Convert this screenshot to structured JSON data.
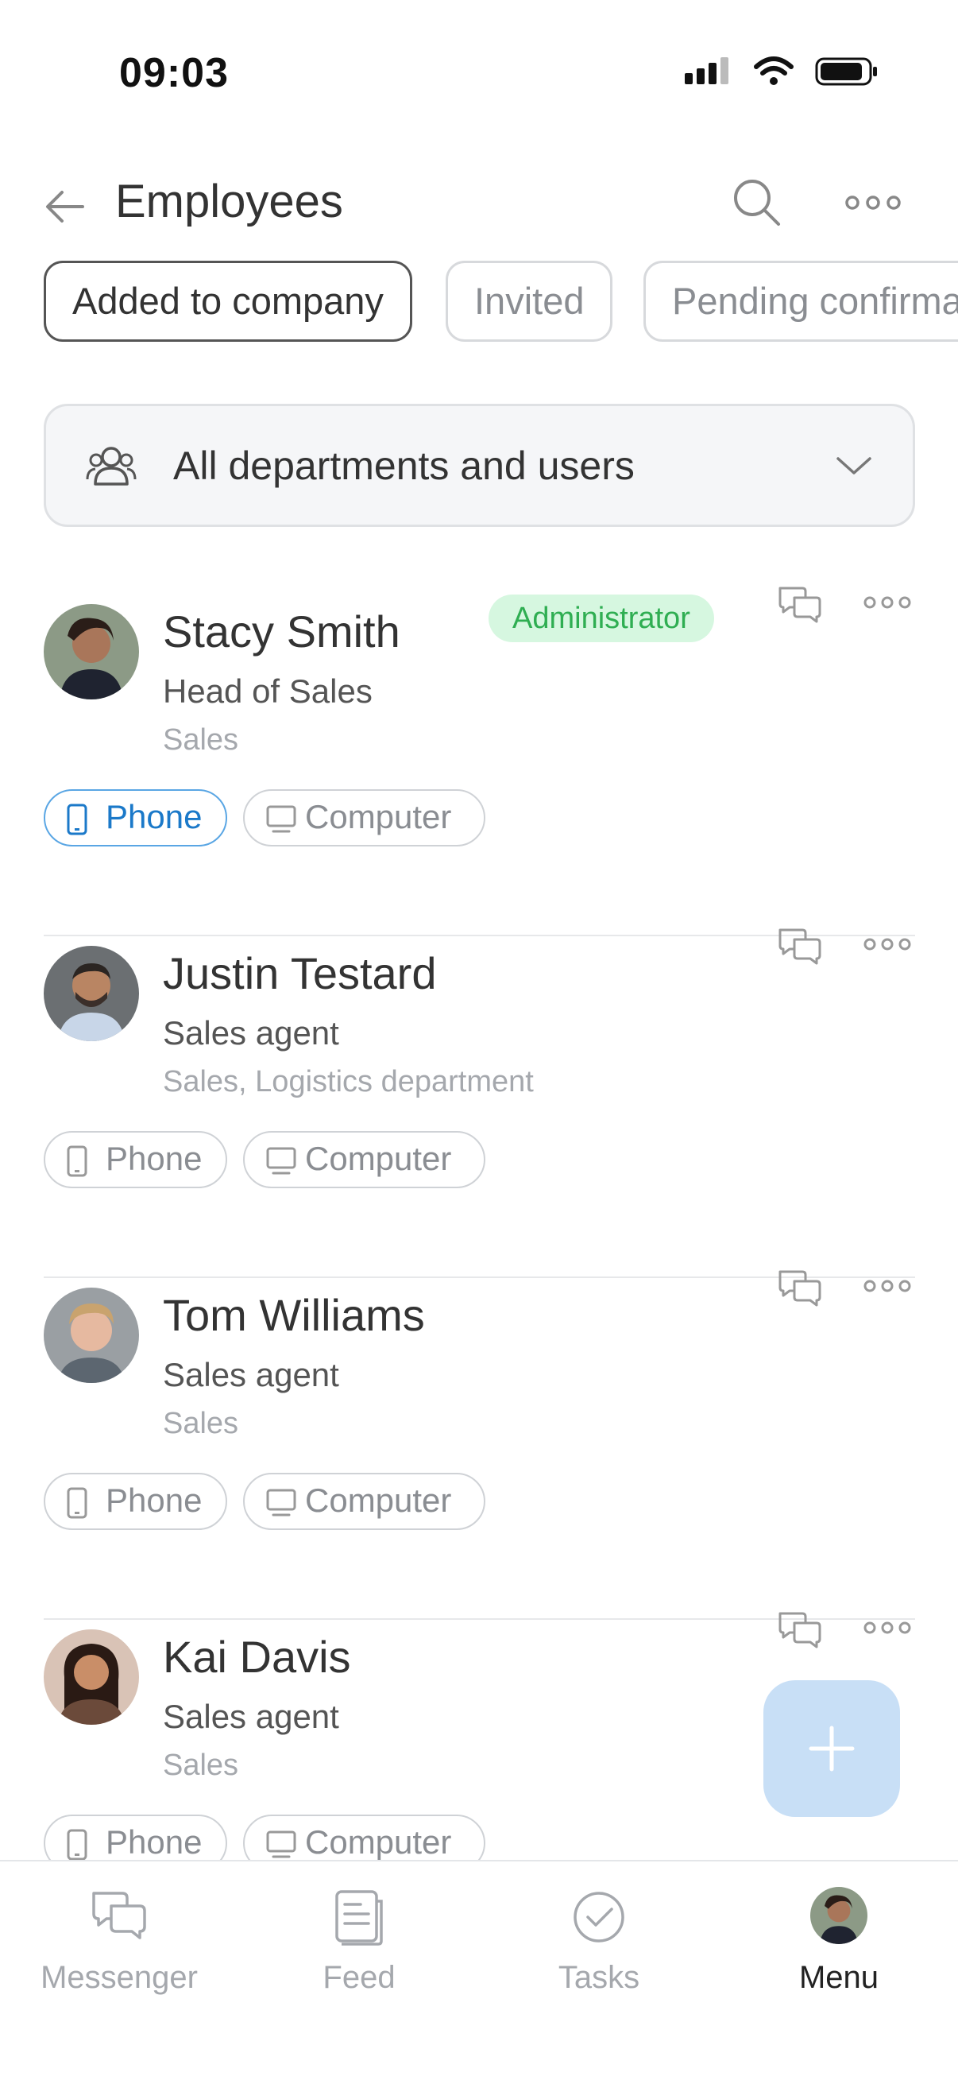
{
  "status_bar": {
    "time": "09:03"
  },
  "header": {
    "title": "Employees"
  },
  "filters": [
    "Added to company",
    "Invited",
    "Pending confirmation"
  ],
  "department_selector": {
    "label": "All departments and users"
  },
  "employees": [
    {
      "name": "Stacy Smith",
      "role": "Head of Sales",
      "department": "Sales",
      "badge": "Administrator",
      "phone_label": "Phone",
      "computer_label": "Computer",
      "phone_active": true
    },
    {
      "name": "Justin Testard",
      "role": "Sales agent",
      "department": "Sales, Logistics department",
      "badge": "",
      "phone_label": "Phone",
      "computer_label": "Computer",
      "phone_active": false
    },
    {
      "name": "Tom Williams",
      "role": "Sales agent",
      "department": "Sales",
      "badge": "",
      "phone_label": "Phone",
      "computer_label": "Computer",
      "phone_active": false
    },
    {
      "name": "Kai Davis",
      "role": "Sales agent",
      "department": "Sales",
      "badge": "",
      "phone_label": "Phone",
      "computer_label": "Computer",
      "phone_active": false
    }
  ],
  "bottom_nav": [
    {
      "label": "Messenger",
      "icon": "messenger-icon"
    },
    {
      "label": "Feed",
      "icon": "feed-icon"
    },
    {
      "label": "Tasks",
      "icon": "tasks-icon"
    },
    {
      "label": "Menu",
      "icon": "avatar",
      "active": true
    }
  ],
  "colors": {
    "admin_badge_bg": "#d6f7e0",
    "admin_badge_text": "#2fae52",
    "active_device": "#1b79c9",
    "fab": "#c8dff6"
  }
}
